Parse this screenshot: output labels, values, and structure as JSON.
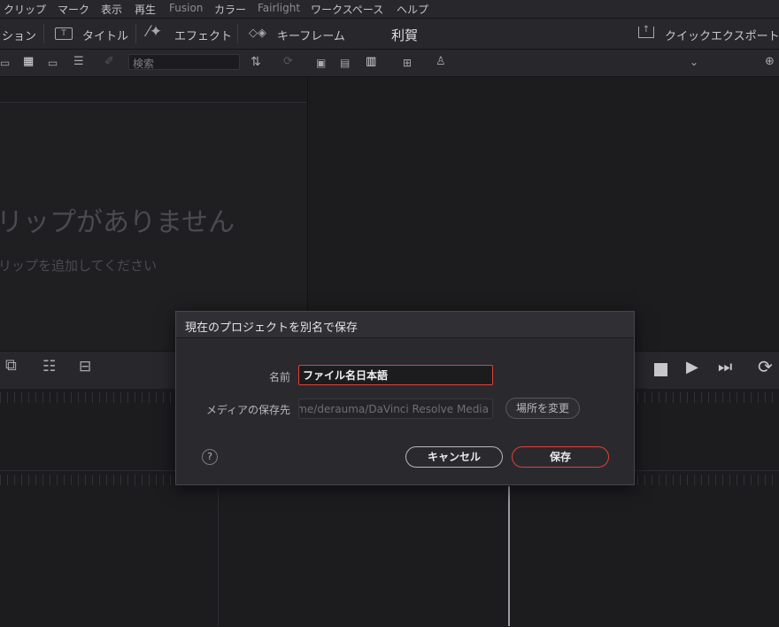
{
  "menu": {
    "items": [
      "クリップ",
      "マーク",
      "表示",
      "再生",
      "Fusion",
      "カラー",
      "Fairlight",
      "ワークスペース",
      "ヘルプ"
    ]
  },
  "toolbar": {
    "left_label": "ション",
    "title_label": "タイトル",
    "effect_label": "エフェクト",
    "keyframe_label": "キーフレーム",
    "project_name": "利賀",
    "quick_export_label": "クイックエクスポート"
  },
  "subbar": {
    "search_placeholder": "検索"
  },
  "media_pool": {
    "empty_title": "リップがありません",
    "empty_hint": "リップを追加してください"
  },
  "dialog": {
    "title": "現在のプロジェクトを別名で保存",
    "name_label": "名前",
    "name_value": "ファイル名日本語",
    "location_label": "メディアの保存先",
    "location_value": "home/derauma/DaVinci Resolve Media",
    "change_location_button": "場所を変更",
    "help_button": "?",
    "cancel_button": "キャンセル",
    "save_button": "保存"
  },
  "colors": {
    "accent": "#e0403a",
    "background": "#1e1e21",
    "panel": "#28282c"
  },
  "icons": {
    "title": "title-icon",
    "effect": "magic-wand-icon",
    "keyframe": "keyframe-icon",
    "quick_export": "export-icon",
    "sort": "sort-icon",
    "refresh": "refresh-icon",
    "stop": "stop-icon",
    "play": "play-icon",
    "next": "skip-forward-icon",
    "loop": "loop-icon"
  }
}
